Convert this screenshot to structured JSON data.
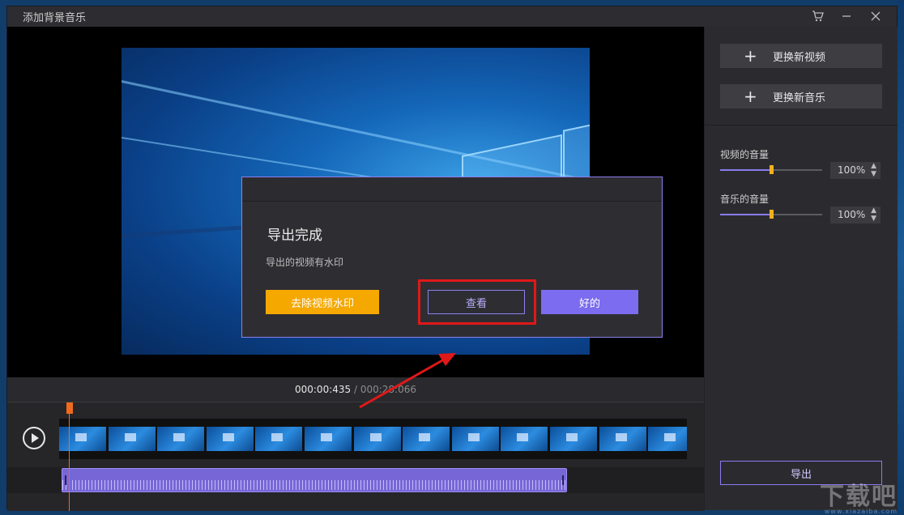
{
  "window": {
    "title": "添加背景音乐",
    "controls": [
      "cart-icon",
      "minimize-icon",
      "close-icon"
    ]
  },
  "preview": {
    "time_current": "000:00:435",
    "time_separator": " / ",
    "time_total": "000:28:066"
  },
  "side": {
    "replace_video_label": "更换新视频",
    "replace_music_label": "更换新音乐",
    "video_volume_label": "视频的音量",
    "video_volume_value": "100%",
    "video_volume_level": 0.5,
    "music_volume_label": "音乐的音量",
    "music_volume_value": "100%",
    "music_volume_level": 0.5,
    "export_label": "导出"
  },
  "dialog": {
    "title": "导出完成",
    "message": "导出的视频有水印",
    "remove_watermark_label": "去除视频水印",
    "view_label": "查看",
    "ok_label": "好的"
  },
  "colors": {
    "accent": "#7b6cf0",
    "warning": "#f5a800",
    "playhead": "#f06a1e",
    "annotation": "#e01818"
  },
  "watermark": {
    "text": "下载吧",
    "url": "www.xiazaiba.com"
  }
}
